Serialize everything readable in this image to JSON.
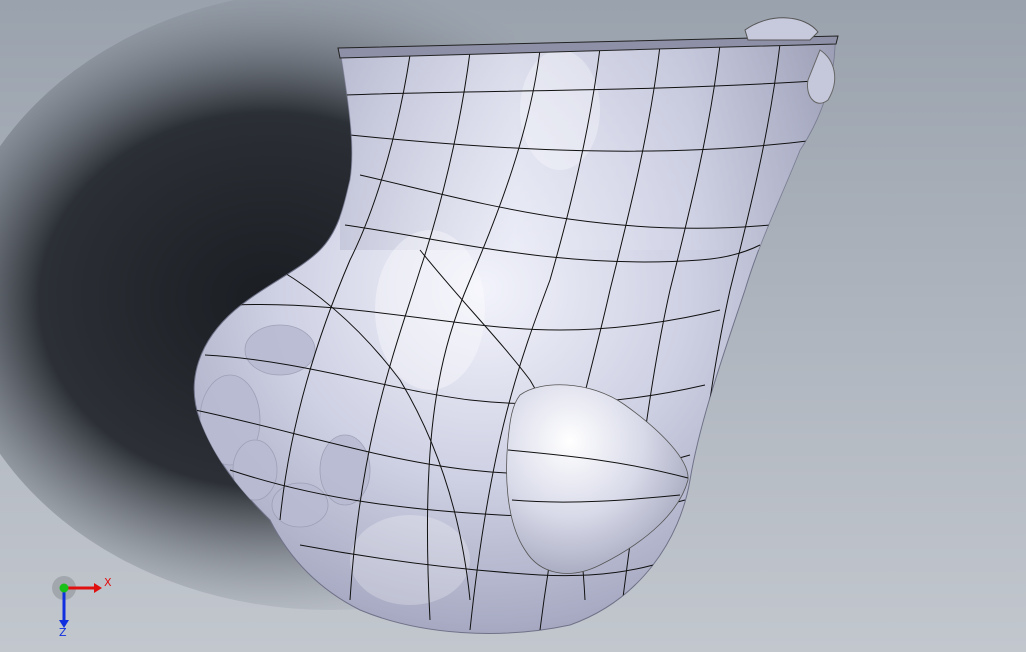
{
  "viewport": {
    "model_name": "organic-foot-scan-surface",
    "background_top": "#9aa2ad",
    "background_bottom": "#c2c7ce",
    "surface_color": "#c9cbe0",
    "edge_color": "#111111"
  },
  "triad": {
    "x_label": "X",
    "z_label": "Z",
    "x_color": "#e01010",
    "y_color": "#18c018",
    "z_color": "#1030e0"
  }
}
